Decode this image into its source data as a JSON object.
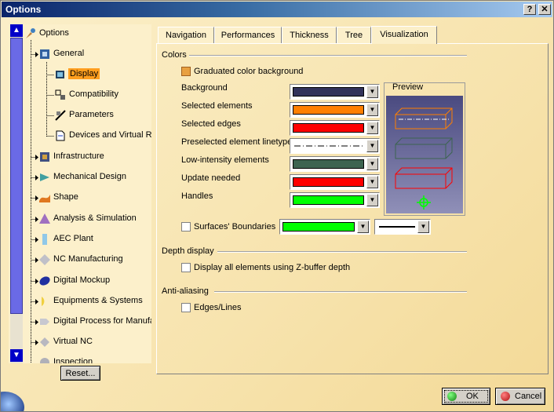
{
  "window": {
    "title": "Options",
    "help_label": "?",
    "close_label": "✕"
  },
  "tree": {
    "root": {
      "label": "Options",
      "icon": "options-icon"
    },
    "items": [
      {
        "label": "General",
        "icon": "general-icon"
      },
      {
        "label": "Display",
        "icon": "display-icon",
        "selected": true
      },
      {
        "label": "Compatibility",
        "icon": "compatibility-icon"
      },
      {
        "label": "Parameters",
        "icon": "parameters-icon"
      },
      {
        "label": "Devices and Virtual Re",
        "icon": "devices-icon"
      },
      {
        "label": "Infrastructure",
        "icon": "infrastructure-icon"
      },
      {
        "label": "Mechanical Design",
        "icon": "mechanical-design-icon"
      },
      {
        "label": "Shape",
        "icon": "shape-icon"
      },
      {
        "label": "Analysis & Simulation",
        "icon": "analysis-icon"
      },
      {
        "label": "AEC Plant",
        "icon": "aec-plant-icon"
      },
      {
        "label": "NC Manufacturing",
        "icon": "nc-manufacturing-icon"
      },
      {
        "label": "Digital Mockup",
        "icon": "digital-mockup-icon"
      },
      {
        "label": "Equipments & Systems",
        "icon": "equipments-icon"
      },
      {
        "label": "Digital Process for Manufa",
        "icon": "digital-process-icon"
      },
      {
        "label": "Virtual NC",
        "icon": "virtual-nc-icon"
      },
      {
        "label": "Inspection",
        "icon": "inspection-icon"
      }
    ],
    "reset_label": "Reset..."
  },
  "tabs": [
    "Navigation",
    "Performances",
    "Thickness",
    "Tree",
    "Visualization"
  ],
  "active_tab": "Visualization",
  "colors": {
    "group_title": "Colors",
    "graduated_label": "Graduated color background",
    "graduated_checked": true,
    "rows": [
      {
        "label": "Background",
        "color": "#32325a"
      },
      {
        "label": "Selected elements",
        "color": "#ff7f00"
      },
      {
        "label": "Selected edges",
        "color": "#ff0000"
      },
      {
        "label": "Preselected element linetype",
        "color": "dashdot"
      },
      {
        "label": "Low-intensity elements",
        "color": "#3c6450"
      },
      {
        "label": "Update needed",
        "color": "#ff0000"
      },
      {
        "label": "Handles",
        "color": "#00ff00"
      }
    ],
    "preview_label": "Preview",
    "surfaces_label": "Surfaces' Boundaries",
    "surfaces_checked": false,
    "surfaces_color": "#00ff00"
  },
  "depth": {
    "group_title": "Depth display",
    "option_label": "Display all elements using Z-buffer depth",
    "checked": false
  },
  "antialias": {
    "group_title": "Anti-aliasing",
    "option_label": "Edges/Lines",
    "checked": false
  },
  "buttons": {
    "ok_label": "OK",
    "cancel_label": "Cancel"
  }
}
